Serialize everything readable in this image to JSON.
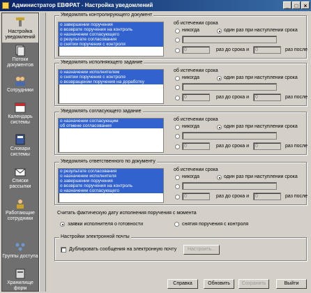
{
  "window": {
    "title": "Администратор ЕВФРАТ - Настройка уведомлений"
  },
  "sidebar": {
    "items": [
      {
        "label": "Настройка уведомлений",
        "icon": "tools-icon"
      },
      {
        "label": "Потоки документов",
        "icon": "document-flow-icon"
      },
      {
        "label": "Сотрудники",
        "icon": "employees-icon"
      },
      {
        "label": "Календарь системы",
        "icon": "calendar-icon"
      },
      {
        "label": "Словари системы",
        "icon": "dictionary-icon"
      },
      {
        "label": "Списки рассылки",
        "icon": "mailing-list-icon"
      },
      {
        "label": "Работающие сотрудники",
        "icon": "working-employees-icon"
      },
      {
        "label": "Группы доступа",
        "icon": "access-groups-icon"
      },
      {
        "label": "Хранилище форм",
        "icon": "forms-storage-icon"
      }
    ]
  },
  "deadline_label": "об истечении срока",
  "options": {
    "never": "никогда",
    "once": "один раз при наступлении срока",
    "before": "раз до срока и",
    "after": "раз после",
    "zero": "0"
  },
  "groups": [
    {
      "title": "Уведомлять контролирующего документ",
      "items": [
        "о завершении поручения",
        "о возврате поручения на контроль",
        "о назначении согласующего",
        "о результате согласования",
        "о снятии поручения с контроля"
      ]
    },
    {
      "title": "Уведомлять исполняющего задание",
      "items": [
        "о назначении исполнителем",
        "о снятии поручения с контроля",
        "о возвращении поручения на доработку"
      ]
    },
    {
      "title": "Уведомлять согласующего задание",
      "items": [
        "о назначении согласующим",
        "об отмене согласования"
      ]
    },
    {
      "title": "Уведомлять ответственного по документу",
      "items": [
        "о результате согласования",
        "о назначении исполнителя",
        "о завершении поручения",
        "о возврате поручения на контроль",
        "о назначении согласующего"
      ]
    }
  ],
  "actual_date": {
    "title": "Считать фактическую дату исполнения поручения с момента",
    "option1": "заявки исполнителя о готовности",
    "option2": "снятия поручения с контроля"
  },
  "email": {
    "title": "Настройки электронной почты",
    "duplicate": "Дублировать сообщения на электронную почту",
    "settings_btn": "Настроить..."
  },
  "buttons": {
    "help": "Справка",
    "refresh": "Обновить",
    "save": "Сохранить",
    "exit": "Выйти"
  }
}
